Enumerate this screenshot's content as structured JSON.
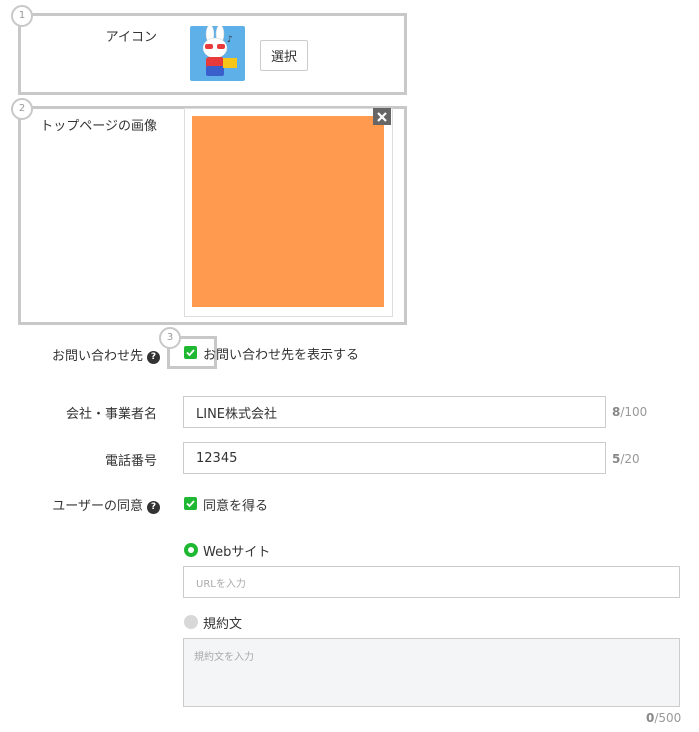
{
  "annotations": [
    "1",
    "2",
    "3"
  ],
  "icon_section": {
    "label": "アイコン",
    "select_button": "選択"
  },
  "top_image_section": {
    "label": "トップページの画像",
    "image_color": "#ff9a4f"
  },
  "contact": {
    "label": "お問い合わせ先",
    "checkbox_label": "お問い合わせ先を表示する",
    "checked": true
  },
  "company": {
    "label": "会社・事業者名",
    "value": "LINE株式会社",
    "count": "8",
    "max": "/100"
  },
  "phone": {
    "label": "電話番号",
    "value": "12345",
    "count": "5",
    "max": "/20"
  },
  "consent": {
    "label": "ユーザーの同意",
    "checkbox_label": "同意を得る",
    "checked": true,
    "options": [
      {
        "label": "Webサイト",
        "selected": true,
        "placeholder": "URLを入力"
      },
      {
        "label": "規約文",
        "selected": false,
        "placeholder": "規約文を入力"
      }
    ],
    "terms_count": "0",
    "terms_max": "/500"
  },
  "colors": {
    "accent": "#1fb832",
    "annotation": "#c8c8c8"
  }
}
